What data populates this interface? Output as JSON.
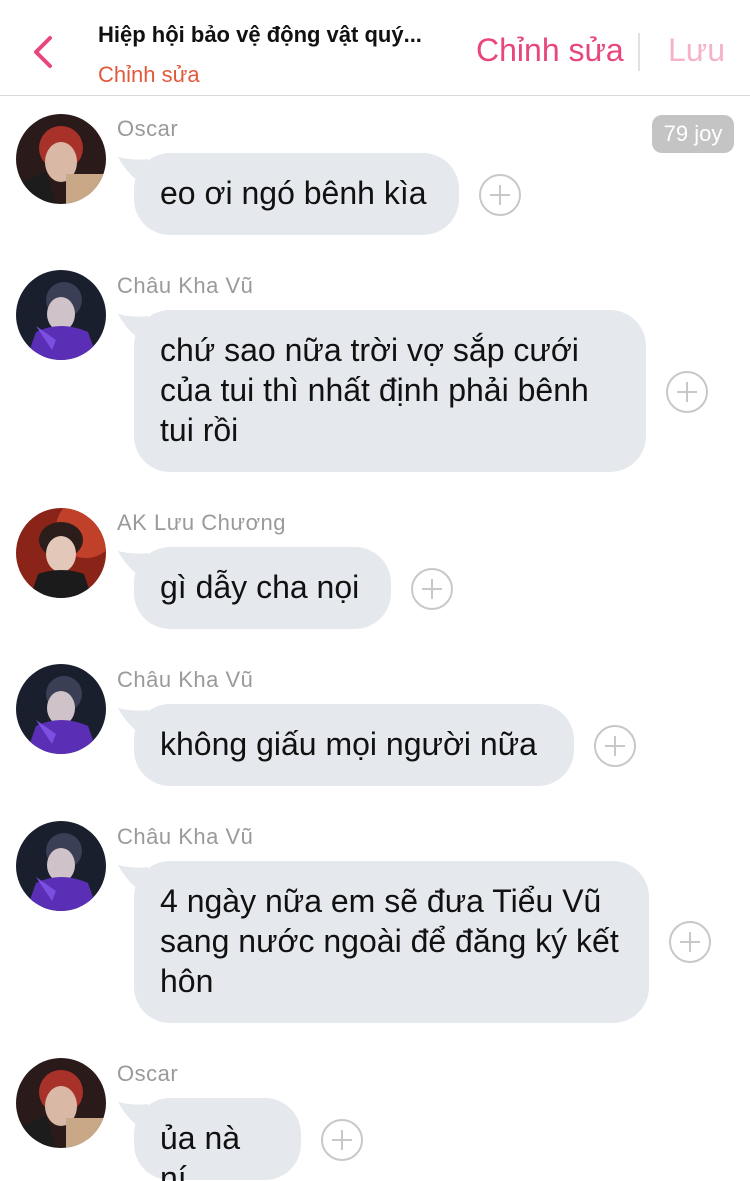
{
  "header": {
    "title": "Hiệp hội bảo vệ động vật quý...",
    "subtitle": "Chỉnh sửa",
    "edit_label": "Chỉnh sửa",
    "save_label": "Lưu"
  },
  "colors": {
    "accent": "#e8467c",
    "subtitle": "#e25a3c",
    "save_disabled": "#f5b3c9",
    "bubble_bg": "#e5e8ec",
    "sender_text": "#9a9a9a"
  },
  "joy_badge": "79 joy",
  "messages": [
    {
      "sender": "Oscar",
      "text": "eo ơi ngó bênh kìa"
    },
    {
      "sender": "Châu Kha Vũ",
      "text": "chứ sao nữa trời vợ sắp cưới của tui thì nhất định phải bênh tui rồi"
    },
    {
      "sender": "AK Lưu Chương",
      "text": "gì dẫy cha nọi"
    },
    {
      "sender": "Châu Kha Vũ",
      "text": "không giấu mọi người nữa"
    },
    {
      "sender": "Châu Kha Vũ",
      "text": "4 ngày nữa em sẽ đưa Tiểu Vũ sang nước ngoài để đăng ký kết hôn"
    },
    {
      "sender": "Oscar",
      "text": "ủa nà ní"
    }
  ],
  "icons": {
    "back": "chevron-left-icon",
    "add_reaction": "plus-circle-icon"
  }
}
